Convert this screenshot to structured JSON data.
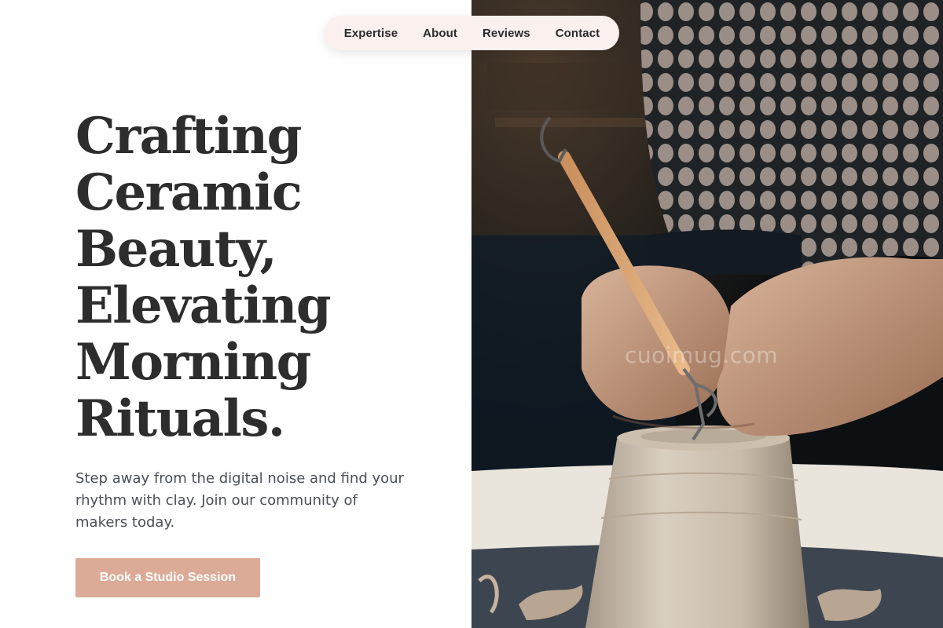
{
  "nav": {
    "items": [
      {
        "label": "Expertise"
      },
      {
        "label": "About"
      },
      {
        "label": "Reviews"
      },
      {
        "label": "Contact"
      }
    ]
  },
  "hero": {
    "headline_lines": [
      "Crafting",
      "Ceramic",
      "Beauty,",
      "Elevating",
      "Morning",
      "Rituals."
    ],
    "subtext": "Step away from the digital noise and find your rhythm with clay. Join our community of makers today.",
    "cta_label": "Book a Studio Session"
  },
  "image": {
    "subject": "hands carving a clay pot on a pottery wheel",
    "watermark": "cuoimug.com"
  },
  "colors": {
    "accent": "#dcab97",
    "nav_bg": "#faf0ee",
    "headline": "#2d2d2d",
    "body_text": "#4a4f57"
  }
}
